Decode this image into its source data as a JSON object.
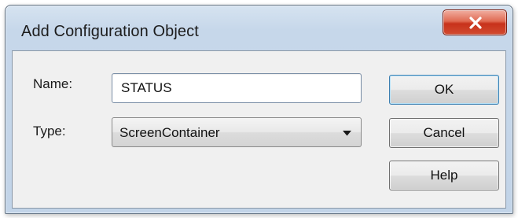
{
  "dialog": {
    "title": "Add Configuration Object",
    "close_icon": "close-x-icon"
  },
  "form": {
    "name_label": "Name:",
    "name_value": "STATUS",
    "type_label": "Type:",
    "type_value": "ScreenContainer",
    "dropdown_icon": "chevron-down-icon"
  },
  "buttons": {
    "ok_label": "OK",
    "cancel_label": "Cancel",
    "help_label": "Help"
  },
  "colors": {
    "close_button": "#c8321b",
    "frame": "#c2d4e8",
    "client": "#f0f0f0"
  }
}
